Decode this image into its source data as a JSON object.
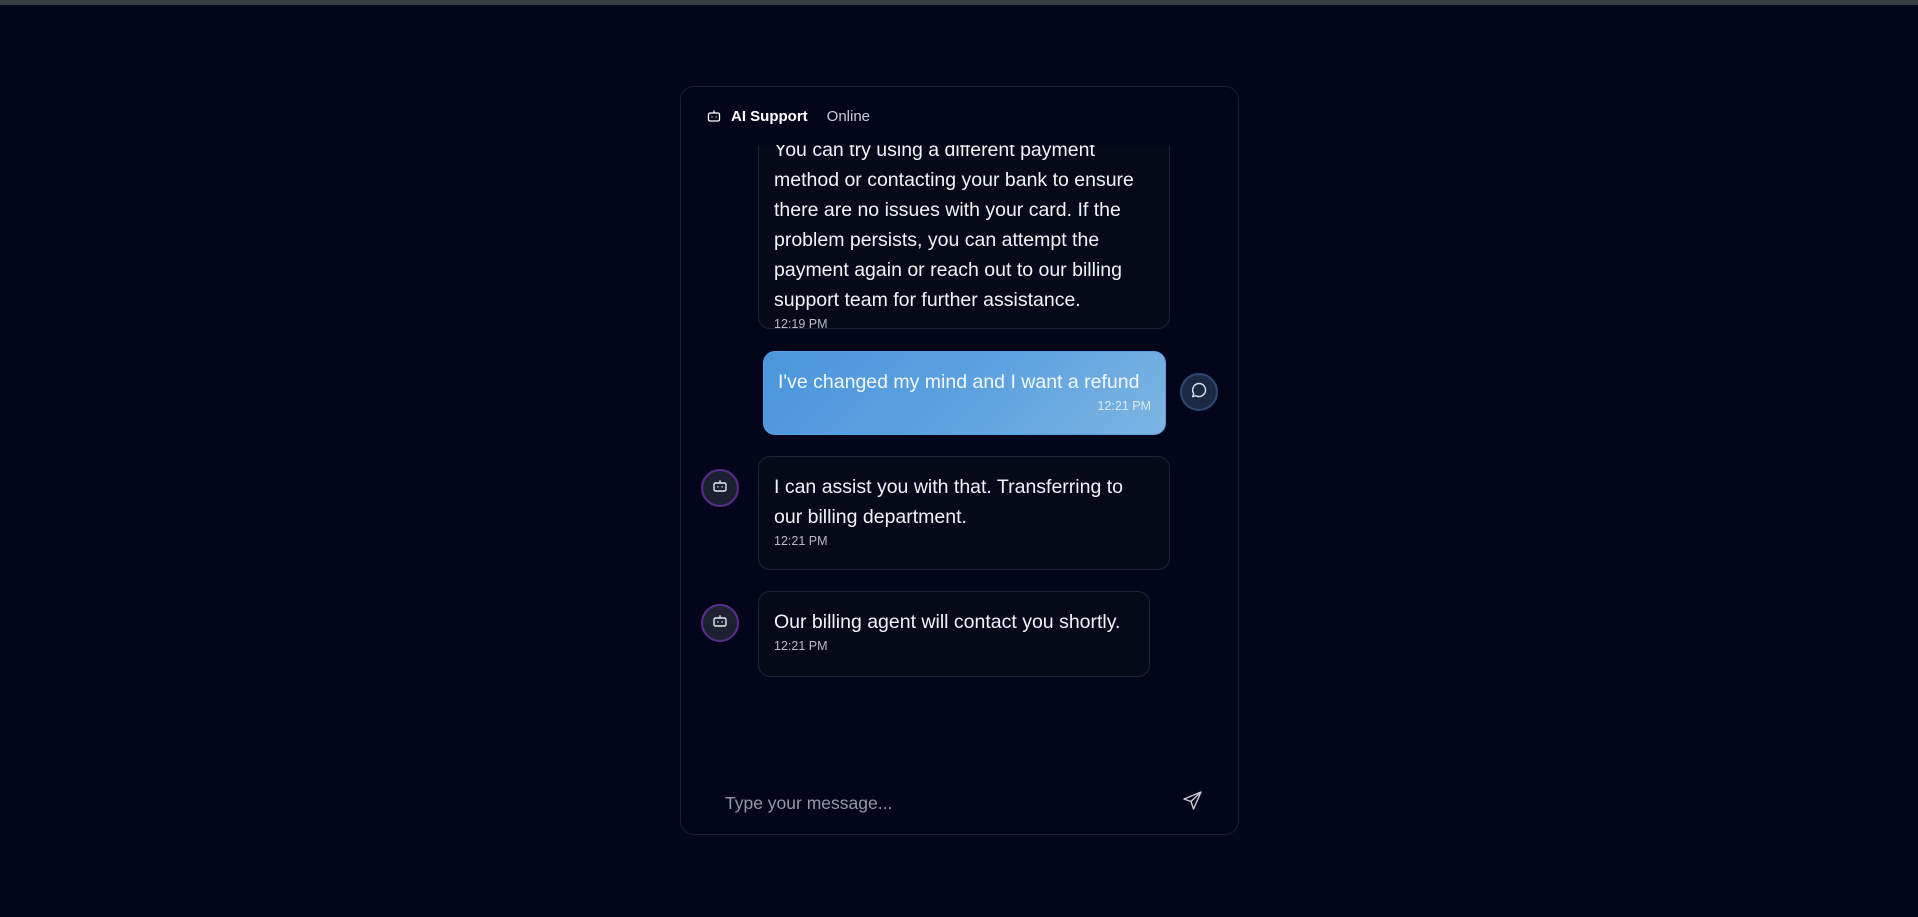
{
  "header": {
    "icon": "bot-icon",
    "title": "AI Support",
    "status": "Online"
  },
  "messages": [
    {
      "sender": "bot",
      "avatar_icon": "bot-icon",
      "text": "You can try using a different payment method or contacting your bank to ensure there are no issues with your card. If the problem persists, you can attempt the payment again or reach out to our billing support team for further assistance.",
      "time": "12:19 PM"
    },
    {
      "sender": "user",
      "avatar_icon": "chat-bubble-icon",
      "text": "I've changed my mind and I want a refund",
      "time": "12:21 PM"
    },
    {
      "sender": "bot",
      "avatar_icon": "bot-icon",
      "text": "I can assist you with that. Transferring to our billing department.",
      "time": "12:21 PM"
    },
    {
      "sender": "bot",
      "avatar_icon": "bot-icon",
      "text": "Our billing agent will contact you shortly.",
      "time": "12:21 PM"
    }
  ],
  "input": {
    "placeholder": "Type your message...",
    "value": "",
    "send_icon": "send-icon"
  },
  "colors": {
    "background": "#04061a",
    "bot_bubble": "#060a18",
    "user_bubble_start": "#4a95dc",
    "user_bubble_end": "#7db5e2",
    "bot_avatar_border": "#5b2e8e"
  }
}
